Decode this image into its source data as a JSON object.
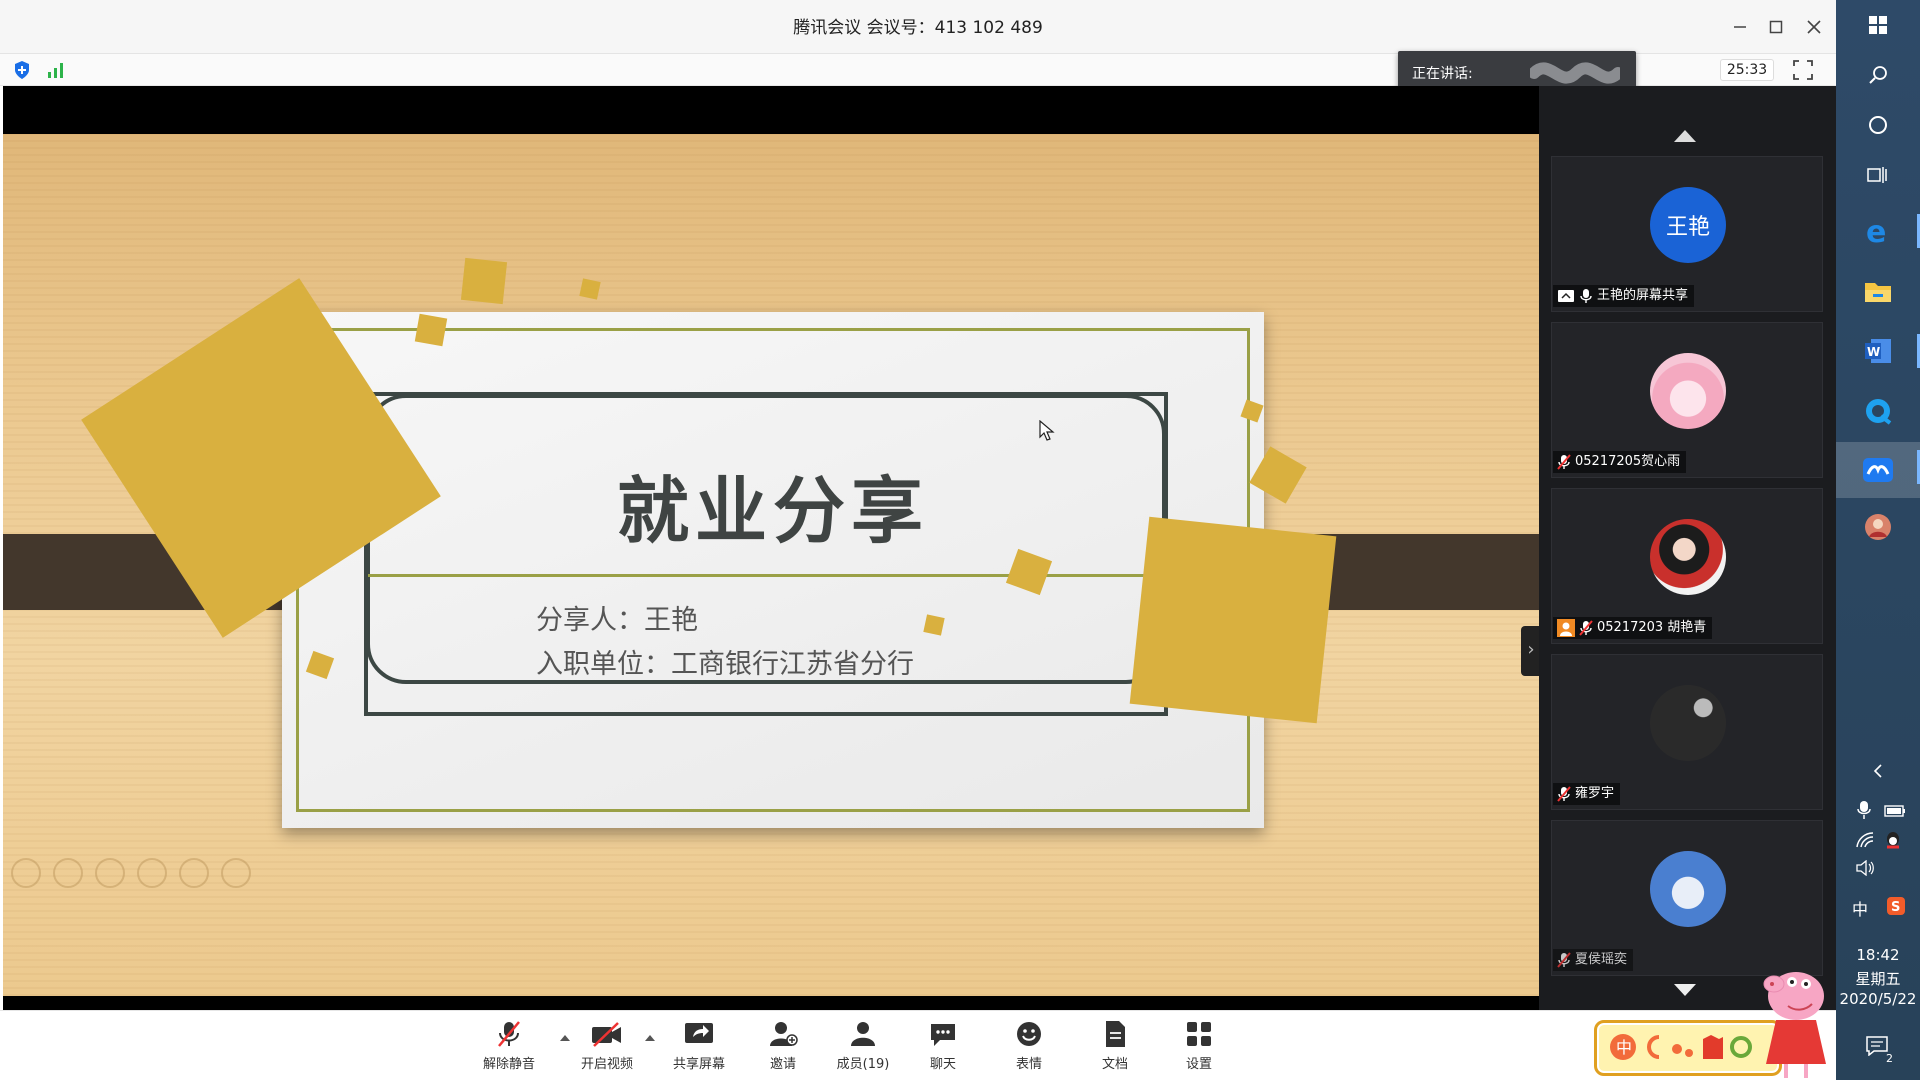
{
  "window": {
    "title": "腾讯会议 会议号：413 102 489",
    "timer": "25:33",
    "speaking_label": "正在讲话:",
    "controls": [
      "minimize",
      "maximize",
      "close"
    ]
  },
  "slide": {
    "title": "就业分享",
    "presenter": "分享人：王艳",
    "employer": "入职单位：工商银行江苏省分行",
    "accent_color": "#d9b03f",
    "frame_color": "#9aa046",
    "border_color": "#3c4744"
  },
  "participants": [
    {
      "name": "王艳的屏幕共享",
      "avatar_text": "王艳",
      "avatar_color": "#1a63d6",
      "icons": [
        "screen-share-icon",
        "mic-icon"
      ]
    },
    {
      "name": "05217205贺心雨",
      "avatar_color": "#f4b8c8",
      "icons": [
        "mic-muted-icon"
      ]
    },
    {
      "name": "05217203 胡艳青",
      "avatar_color": "#c9302c",
      "icons": [
        "person-icon",
        "mic-muted-icon"
      ]
    },
    {
      "name": "雍罗宇",
      "avatar_color": "#333333",
      "icons": [
        "mic-muted-icon"
      ]
    },
    {
      "name": "夏侯瑶奕",
      "avatar_color": "#4a7fd0",
      "icons": [
        "mic-muted-icon"
      ]
    }
  ],
  "controlbar": {
    "unmute": "解除静音",
    "video": "开启视频",
    "share": "共享屏幕",
    "invite": "邀请",
    "members": "成员(19)",
    "chat": "聊天",
    "emoji": "表情",
    "docs": "文档",
    "settings": "设置"
  },
  "taskbar": {
    "ime": "中",
    "time": "18:42",
    "weekday": "星期五",
    "date": "2020/5/22",
    "notifications": "2"
  }
}
